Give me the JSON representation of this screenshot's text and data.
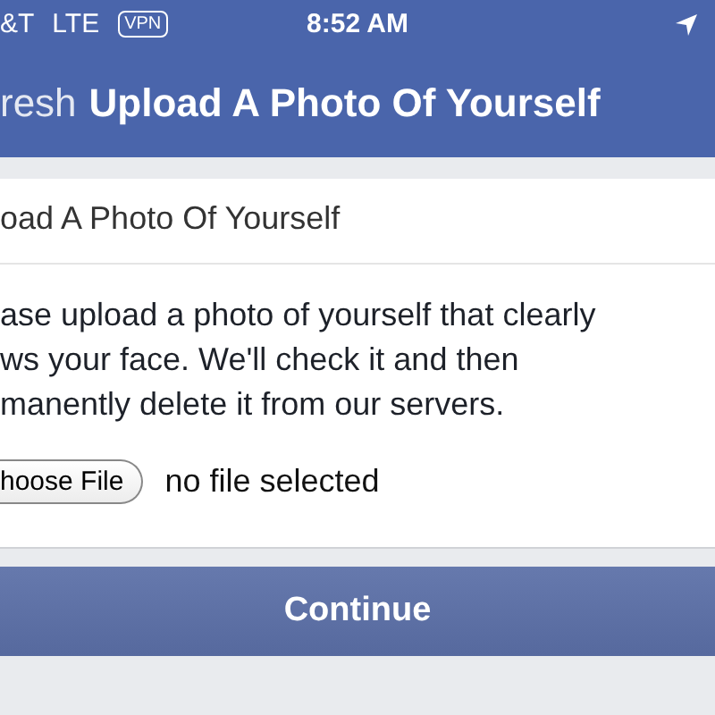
{
  "status_bar": {
    "carrier": "&T",
    "network": "LTE",
    "vpn": "VPN",
    "time": "8:52 AM"
  },
  "nav_bar": {
    "back": "resh",
    "title": "Upload A Photo Of Yourself"
  },
  "card": {
    "heading": "oad A Photo Of Yourself",
    "lines": [
      "ase upload a photo of yourself that clearly",
      "ws your face. We'll check it and then",
      "manently delete it from our servers."
    ],
    "file_button": "hoose File",
    "file_status": "no file selected"
  },
  "continue_button": "Continue"
}
